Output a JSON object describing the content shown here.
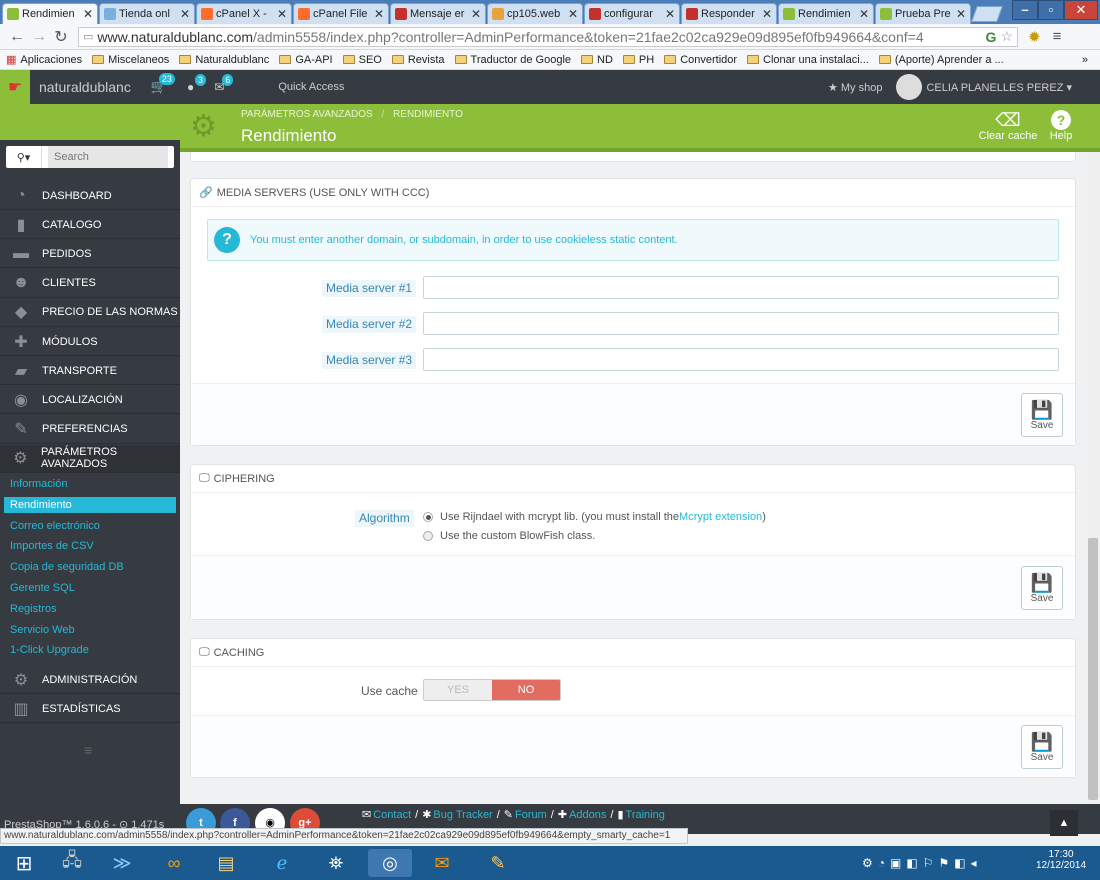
{
  "browser": {
    "tabs": [
      {
        "title": "Rendimien",
        "icon_color": "#8cbe3a",
        "icon": "prestashop-icon",
        "active": true
      },
      {
        "title": "Tienda onl",
        "icon_color": "#7ab0e0",
        "icon": "page-icon"
      },
      {
        "title": "cPanel X -",
        "icon_color": "#ff6c2c",
        "icon": "cpanel-icon"
      },
      {
        "title": "cPanel File",
        "icon_color": "#ff6c2c",
        "icon": "cpanel-icon"
      },
      {
        "title": "Mensaje er",
        "icon_color": "#c4302b",
        "icon": "w-icon"
      },
      {
        "title": "cp105.web",
        "icon_color": "#e8a33d",
        "icon": "phpmyadmin-icon"
      },
      {
        "title": "configurar",
        "icon_color": "#c4302b",
        "icon": "w-icon"
      },
      {
        "title": "Responder",
        "icon_color": "#c4302b",
        "icon": "w-icon"
      },
      {
        "title": "Rendimien",
        "icon_color": "#8cbe3a",
        "icon": "prestashop-icon"
      },
      {
        "title": "Prueba Pre",
        "icon_color": "#8cbe3a",
        "icon": "prestashop-icon"
      }
    ],
    "url_host": "www.naturaldublanc.com",
    "url_path": "/admin5558/index.php?controller=AdminPerformance&token=21fae2c02ca929e09d895ef0fb949664&conf=4",
    "bookmarks": [
      "Aplicaciones",
      "Miscelaneos",
      "Naturaldublanc",
      "GA-API",
      "SEO",
      "Revista",
      "Traductor de Google",
      "ND",
      "PH",
      "Convertidor",
      "Clonar una instalaci...",
      "(Aporte) Aprender a ..."
    ],
    "bookmarks_more": "»",
    "status_url": "www.naturaldublanc.com/admin5558/index.php?controller=AdminPerformance&token=21fae2c02ca929e09d895ef0fb949664&empty_smarty_cache=1"
  },
  "header": {
    "shop_name": "naturaldublanc",
    "badges": {
      "orders": "23",
      "customers": "3",
      "messages": "6"
    },
    "quick_access": "Quick Access",
    "my_shop": "My shop",
    "user": "CELIA PLANELLES PEREZ"
  },
  "page": {
    "breadcrumb_parent": "PARÁMETROS AVANZADOS",
    "breadcrumb_sep": "/",
    "breadcrumb_current": "RENDIMIENTO",
    "title": "Rendimiento",
    "clear_cache": "Clear cache",
    "help": "Help"
  },
  "search": {
    "placeholder": "Search"
  },
  "sidebar": {
    "items": [
      {
        "label": "DASHBOARD",
        "icon": "dashboard-icon"
      },
      {
        "label": "CATALOGO",
        "icon": "book-icon"
      },
      {
        "label": "PEDIDOS",
        "icon": "credit-card-icon"
      },
      {
        "label": "CLIENTES",
        "icon": "users-icon"
      },
      {
        "label": "PRECIO DE LAS NORMAS",
        "icon": "tag-icon"
      },
      {
        "label": "MÓDULOS",
        "icon": "puzzle-icon"
      },
      {
        "label": "TRANSPORTE",
        "icon": "truck-icon"
      },
      {
        "label": "LOCALIZACIÓN",
        "icon": "globe-icon"
      },
      {
        "label": "PREFERENCIAS",
        "icon": "wrench-icon"
      },
      {
        "label": "PARÁMETROS AVANZADOS",
        "icon": "gears-icon"
      }
    ],
    "subitems": [
      "Información",
      "Rendimiento",
      "Correo electrónico",
      "Importes de CSV",
      "Copia de seguridad DB",
      "Gerente SQL",
      "Registros",
      "Servicio Web",
      "1-Click Upgrade"
    ],
    "bottom_items": [
      {
        "label": "ADMINISTRACIÓN",
        "icon": "cog-icon"
      },
      {
        "label": "ESTADÍSTICAS",
        "icon": "bar-chart-icon"
      }
    ],
    "version": "PrestaShop™ 1.6.0.6 - ⊙ 1.471s"
  },
  "media_servers": {
    "title": "MEDIA SERVERS (USE ONLY WITH CCC)",
    "info": "You must enter another domain, or subdomain, in order to use cookieless static content.",
    "labels": [
      "Media server #1",
      "Media server #2",
      "Media server #3"
    ],
    "save": "Save"
  },
  "ciphering": {
    "title": "CIPHERING",
    "label": "Algorithm",
    "option1_pre": "Use Rijndael with mcrypt lib. (you must install the ",
    "option1_link": "Mcrypt extension",
    "option1_post": ")",
    "option2": "Use the custom BlowFish class.",
    "save": "Save"
  },
  "caching": {
    "title": "CACHING",
    "label": "Use cache",
    "yes": "YES",
    "no": "NO",
    "save": "Save"
  },
  "footer": {
    "links": [
      "Contact",
      "Bug Tracker",
      "Forum",
      "Addons",
      "Training"
    ],
    "seps": "/"
  },
  "taskbar": {
    "time": "17:30",
    "date": "12/12/2014"
  }
}
